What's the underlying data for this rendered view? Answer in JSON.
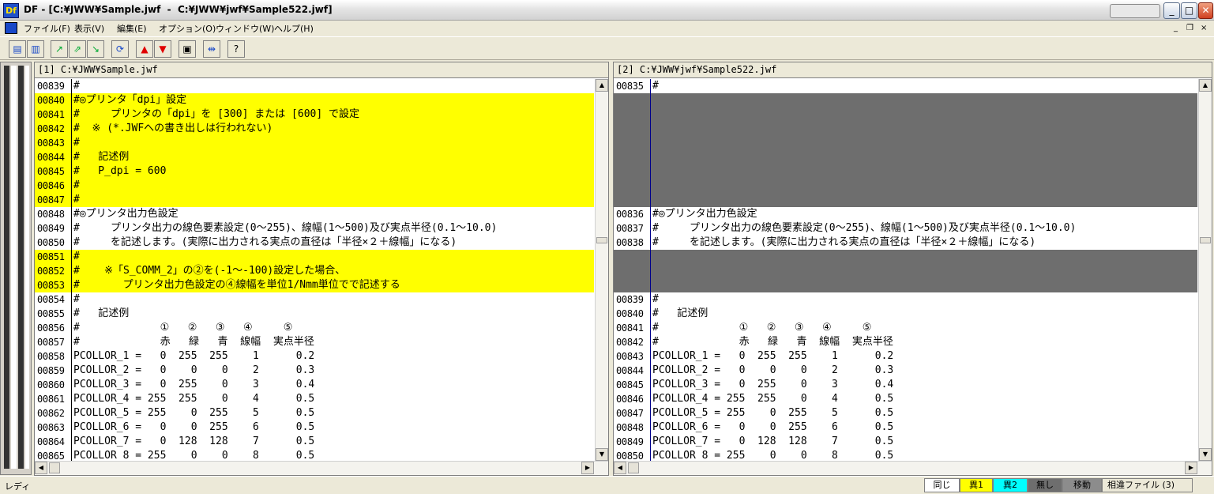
{
  "window": {
    "title": "DF - [C:¥JWW¥Sample.jwf  -  C:¥JWW¥jwf¥Sample522.jwf]",
    "app_icon": "Df"
  },
  "caption_buttons": {
    "minimize": "_",
    "maximize": "□",
    "close": "✕"
  },
  "menu": [
    {
      "label": "ファイル(F)"
    },
    {
      "label": "表示(V)"
    },
    {
      "label": "編集(E)"
    },
    {
      "label": "オプション(O)"
    },
    {
      "label": "ウィンドウ(W)"
    },
    {
      "label": "ヘルプ(H)"
    }
  ],
  "mdi_buttons": {
    "minimize": "_",
    "restore": "❐",
    "close": "×"
  },
  "toolbar": [
    "open-icon",
    "save-icon",
    "prev-diff-icon",
    "next-diff-icon",
    "copy-diff-icon",
    "refresh-icon",
    "up-icon",
    "down-icon",
    "window-icon",
    "split-icon",
    "help-icon"
  ],
  "left": {
    "header": "[1] C:¥JWW¥Sample.jwf",
    "lines": [
      {
        "n": "00839",
        "t": "#",
        "s": "same"
      },
      {
        "n": "00840",
        "t": "#◎プリンタ「dpi」設定",
        "s": "diff1"
      },
      {
        "n": "00841",
        "t": "#     プリンタの「dpi」を [300] または [600] で設定",
        "s": "diff1"
      },
      {
        "n": "00842",
        "t": "#  ※ (*.JWFへの書き出しは行われない)",
        "s": "diff1"
      },
      {
        "n": "00843",
        "t": "#",
        "s": "diff1"
      },
      {
        "n": "00844",
        "t": "#   記述例",
        "s": "diff1"
      },
      {
        "n": "00845",
        "t": "#   P_dpi = 600",
        "s": "diff1"
      },
      {
        "n": "00846",
        "t": "#",
        "s": "diff1"
      },
      {
        "n": "00847",
        "t": "#",
        "s": "diff1"
      },
      {
        "n": "00848",
        "t": "#◎プリンタ出力色設定",
        "s": "same"
      },
      {
        "n": "00849",
        "t": "#     プリンタ出力の線色要素設定(0～255)、線幅(1～500)及び実点半径(0.1～10.0)",
        "s": "same"
      },
      {
        "n": "00850",
        "t": "#     を記述します。(実際に出力される実点の直径は「半径×２＋線幅」になる)",
        "s": "same"
      },
      {
        "n": "00851",
        "t": "#",
        "s": "diff1"
      },
      {
        "n": "00852",
        "t": "#    ※「S_COMM_2」の②を(-1～-100)設定した場合、",
        "s": "diff1"
      },
      {
        "n": "00853",
        "t": "#       プリンタ出力色設定の④線幅を単位1/Nmm単位でで記述する",
        "s": "diff1"
      },
      {
        "n": "00854",
        "t": "#",
        "s": "same"
      },
      {
        "n": "00855",
        "t": "#   記述例",
        "s": "same"
      },
      {
        "n": "00856",
        "t": "#             ①   ②   ③   ④     ⑤",
        "s": "same"
      },
      {
        "n": "00857",
        "t": "#             赤   緑   青  線幅  実点半径",
        "s": "same"
      },
      {
        "n": "00858",
        "t": "PCOLLOR_1 =   0  255  255    1      0.2",
        "s": "same"
      },
      {
        "n": "00859",
        "t": "PCOLLOR_2 =   0    0    0    2      0.3",
        "s": "same"
      },
      {
        "n": "00860",
        "t": "PCOLLOR_3 =   0  255    0    3      0.4",
        "s": "same"
      },
      {
        "n": "00861",
        "t": "PCOLLOR_4 = 255  255    0    4      0.5",
        "s": "same"
      },
      {
        "n": "00862",
        "t": "PCOLLOR_5 = 255    0  255    5      0.5",
        "s": "same"
      },
      {
        "n": "00863",
        "t": "PCOLLOR_6 =   0    0  255    6      0.5",
        "s": "same"
      },
      {
        "n": "00864",
        "t": "PCOLLOR_7 =   0  128  128    7      0.5",
        "s": "same"
      },
      {
        "n": "00865",
        "t": "PCOLLOR 8 = 255    0    0    8      0.5",
        "s": "same"
      }
    ]
  },
  "right": {
    "header": "[2] C:¥JWW¥jwf¥Sample522.jwf",
    "lines": [
      {
        "n": "00835",
        "t": "#",
        "s": "same"
      },
      {
        "n": "",
        "t": "",
        "s": "none"
      },
      {
        "n": "",
        "t": "",
        "s": "none"
      },
      {
        "n": "",
        "t": "",
        "s": "none"
      },
      {
        "n": "",
        "t": "",
        "s": "none"
      },
      {
        "n": "",
        "t": "",
        "s": "none"
      },
      {
        "n": "",
        "t": "",
        "s": "none"
      },
      {
        "n": "",
        "t": "",
        "s": "none"
      },
      {
        "n": "",
        "t": "",
        "s": "none"
      },
      {
        "n": "00836",
        "t": "#◎プリンタ出力色設定",
        "s": "same"
      },
      {
        "n": "00837",
        "t": "#     プリンタ出力の線色要素設定(0～255)、線幅(1～500)及び実点半径(0.1～10.0)",
        "s": "same"
      },
      {
        "n": "00838",
        "t": "#     を記述します。(実際に出力される実点の直径は「半径×２＋線幅」になる)",
        "s": "same"
      },
      {
        "n": "",
        "t": "",
        "s": "none"
      },
      {
        "n": "",
        "t": "",
        "s": "none"
      },
      {
        "n": "",
        "t": "",
        "s": "none"
      },
      {
        "n": "00839",
        "t": "#",
        "s": "same"
      },
      {
        "n": "00840",
        "t": "#   記述例",
        "s": "same"
      },
      {
        "n": "00841",
        "t": "#             ①   ②   ③   ④     ⑤",
        "s": "same"
      },
      {
        "n": "00842",
        "t": "#             赤   緑   青  線幅  実点半径",
        "s": "same"
      },
      {
        "n": "00843",
        "t": "PCOLLOR_1 =   0  255  255    1      0.2",
        "s": "same"
      },
      {
        "n": "00844",
        "t": "PCOLLOR_2 =   0    0    0    2      0.3",
        "s": "same"
      },
      {
        "n": "00845",
        "t": "PCOLLOR_3 =   0  255    0    3      0.4",
        "s": "same"
      },
      {
        "n": "00846",
        "t": "PCOLLOR_4 = 255  255    0    4      0.5",
        "s": "same"
      },
      {
        "n": "00847",
        "t": "PCOLLOR_5 = 255    0  255    5      0.5",
        "s": "same"
      },
      {
        "n": "00848",
        "t": "PCOLLOR_6 =   0    0  255    6      0.5",
        "s": "same"
      },
      {
        "n": "00849",
        "t": "PCOLLOR_7 =   0  128  128    7      0.5",
        "s": "same"
      },
      {
        "n": "00850",
        "t": "PCOLLOR 8 = 255    0    0    8      0.5",
        "s": "same"
      }
    ]
  },
  "status": {
    "text": "レディ",
    "legend": [
      {
        "label": "同じ",
        "color": "#ffffff"
      },
      {
        "label": "異1",
        "color": "#ffff00"
      },
      {
        "label": "異2",
        "color": "#00ffff"
      },
      {
        "label": "無し",
        "color": "#6e6e6e"
      },
      {
        "label": "移動",
        "color": "#8c8c8c"
      },
      {
        "label": "相違ファイル (3)",
        "color": "#ece9d8"
      }
    ]
  }
}
